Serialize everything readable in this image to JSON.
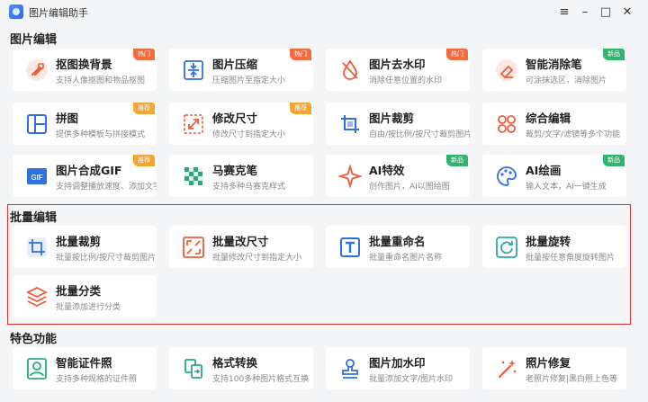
{
  "window": {
    "title": "图片编辑助手",
    "controls": [
      "≡",
      "–",
      "□",
      "✕"
    ]
  },
  "sections": [
    {
      "title": "图片编辑",
      "items": [
        {
          "name": "抠图换背景",
          "desc": "支持人像抠图和物品抠图",
          "badge": "热门",
          "icon": "cutout-icon"
        },
        {
          "name": "图片压缩",
          "desc": "压缩图片至指定大小",
          "badge": "热门",
          "icon": "compress-icon"
        },
        {
          "name": "图片去水印",
          "desc": "消除任意位置的水印",
          "badge": "热门",
          "icon": "remove-watermark-icon"
        },
        {
          "name": "智能消除笔",
          "desc": "可涂抹选区，消除图片",
          "badge": "新品",
          "icon": "eraser-icon"
        },
        {
          "name": "拼图",
          "desc": "提供多种模板与拼接模式",
          "badge": "推荐",
          "icon": "collage-icon"
        },
        {
          "name": "修改尺寸",
          "desc": "修改尺寸到指定大小",
          "badge": "推荐",
          "icon": "resize-icon"
        },
        {
          "name": "图片裁剪",
          "desc": "自由/按比例/按尺寸裁剪图片",
          "badge": "",
          "icon": "crop-icon"
        },
        {
          "name": "综合编辑",
          "desc": "裁剪/文字/滤镜等多个功能",
          "badge": "",
          "icon": "edit-icon"
        },
        {
          "name": "图片合成GIF",
          "desc": "支持调整播放速度、添加文字",
          "badge": "推荐",
          "icon": "gif-icon"
        },
        {
          "name": "马赛克笔",
          "desc": "支持多种马赛克样式",
          "badge": "",
          "icon": "mosaic-icon"
        },
        {
          "name": "AI特效",
          "desc": "创作图片，AI以图绘图",
          "badge": "新品",
          "icon": "ai-effect-icon"
        },
        {
          "name": "AI绘画",
          "desc": "输入文本，AI一键生成",
          "badge": "新品",
          "icon": "ai-paint-icon"
        }
      ]
    },
    {
      "title": "批量编辑",
      "items": [
        {
          "name": "批量裁剪",
          "desc": "批量按比例/按尺寸裁剪图片",
          "badge": "",
          "icon": "batch-crop-icon"
        },
        {
          "name": "批量改尺寸",
          "desc": "批量修改尺寸到指定大小",
          "badge": "",
          "icon": "batch-resize-icon"
        },
        {
          "name": "批量重命名",
          "desc": "批量重命名图片名称",
          "badge": "",
          "icon": "batch-rename-icon"
        },
        {
          "name": "批量旋转",
          "desc": "批量按任意角度旋转图片",
          "badge": "",
          "icon": "batch-rotate-icon"
        },
        {
          "name": "批量分类",
          "desc": "批量添加进行分类",
          "badge": "",
          "icon": "batch-classify-icon"
        }
      ]
    },
    {
      "title": "特色功能",
      "items": [
        {
          "name": "智能证件照",
          "desc": "支持多种规格的证件照",
          "badge": "",
          "icon": "id-photo-icon"
        },
        {
          "name": "格式转换",
          "desc": "支持100多种图片格式互换",
          "badge": "",
          "icon": "convert-icon"
        },
        {
          "name": "图片加水印",
          "desc": "批量添加文字/图片水印",
          "badge": "",
          "icon": "add-watermark-icon"
        },
        {
          "name": "照片修复",
          "desc": "老照片修复|黑白照上色等",
          "badge": "",
          "icon": "repair-icon"
        }
      ]
    }
  ],
  "colors": {
    "accent_blue": "#2f6fe0",
    "accent_orange": "#f05a3a",
    "badge_hot": "#f56b3d",
    "badge_recommend": "#f7a531",
    "badge_new": "#2fb56c",
    "highlight_border": "#e3302f"
  }
}
